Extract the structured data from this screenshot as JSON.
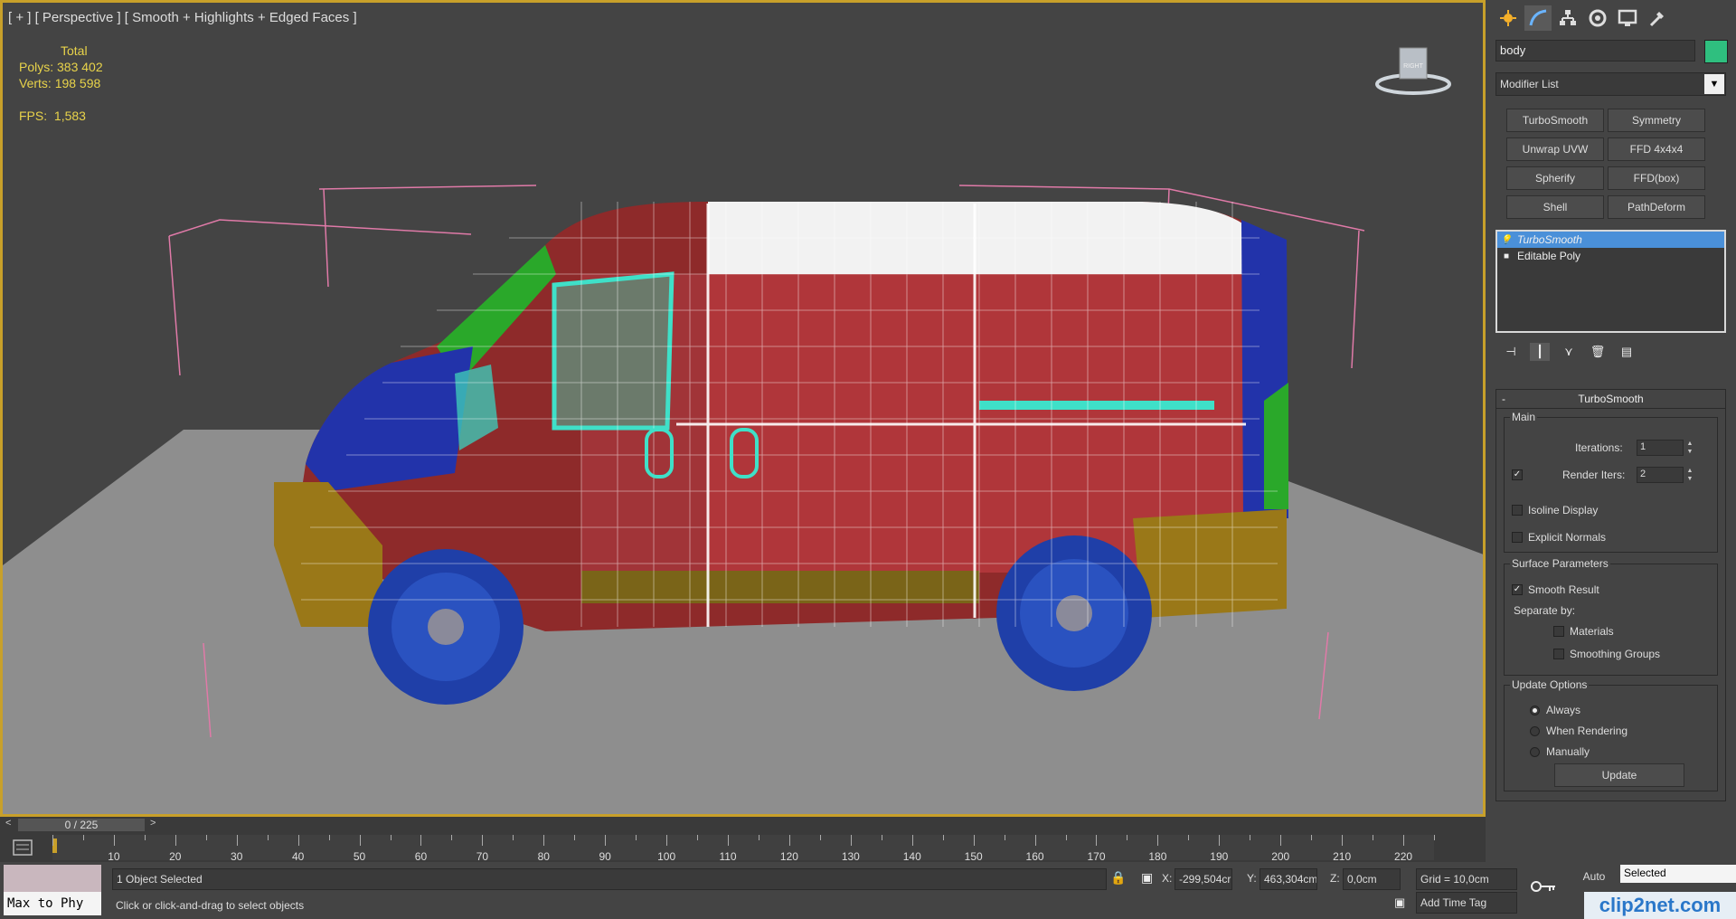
{
  "viewport": {
    "label": "[ + ] [ Perspective ] [ Smooth + Highlights + Edged Faces ]",
    "stats": {
      "total_label": "Total",
      "polys_label": "Polys:",
      "polys_value": "383 402",
      "verts_label": "Verts:",
      "verts_value": "198 598",
      "fps_label": "FPS:",
      "fps_value": "1,583"
    },
    "viewcube_label": "RIGHT"
  },
  "command_panel": {
    "tabs": [
      "create-tab",
      "modify-tab",
      "hierarchy-tab",
      "motion-tab",
      "display-tab",
      "utilities-tab"
    ],
    "object_name": "body",
    "object_color": "#2fbf7f",
    "modifier_list": "Modifier List",
    "modifier_buttons": [
      "TurboSmooth",
      "Symmetry",
      "Unwrap UVW",
      "FFD 4x4x4",
      "Spherify",
      "FFD(box)",
      "Shell",
      "PathDeform"
    ],
    "stack": [
      {
        "label": "TurboSmooth",
        "selected": true
      },
      {
        "label": "Editable Poly",
        "selected": false
      }
    ]
  },
  "turbosmooth": {
    "title": "TurboSmooth",
    "collapse": "-",
    "main_group": "Main",
    "iterations_label": "Iterations:",
    "iterations_value": "1",
    "render_iters_label": "Render Iters:",
    "render_iters_value": "2",
    "render_iters_checked": true,
    "isoline_label": "Isoline Display",
    "explicit_normals_label": "Explicit Normals",
    "surface_group": "Surface Parameters",
    "smooth_result_label": "Smooth Result",
    "smooth_result_checked": true,
    "separate_by_label": "Separate by:",
    "materials_label": "Materials",
    "smoothing_groups_label": "Smoothing Groups",
    "update_group": "Update Options",
    "always_label": "Always",
    "when_rendering_label": "When Rendering",
    "manually_label": "Manually",
    "update_button": "Update"
  },
  "timeline": {
    "frame_label": "0 / 225",
    "left_arrow": "<",
    "right_arrow": ">",
    "ticks": [
      "10",
      "20",
      "30",
      "40",
      "50",
      "60",
      "70",
      "80",
      "90",
      "100",
      "110",
      "120",
      "130",
      "140",
      "150",
      "160",
      "170",
      "180",
      "190",
      "200",
      "210",
      "220"
    ]
  },
  "status": {
    "maxscript": "Max to Phy",
    "selection_info": "1 Object Selected",
    "prompt": "Click or click-and-drag to select objects",
    "x_label": "X:",
    "x_value": "-299,504cr",
    "y_label": "Y:",
    "y_value": "463,304cm",
    "z_label": "Z:",
    "z_value": "0,0cm",
    "grid": "Grid = 10,0cm",
    "add_time_tag": "Add Time Tag",
    "auto": "Auto",
    "selected": "Selected"
  },
  "watermark": "clip2net.com"
}
